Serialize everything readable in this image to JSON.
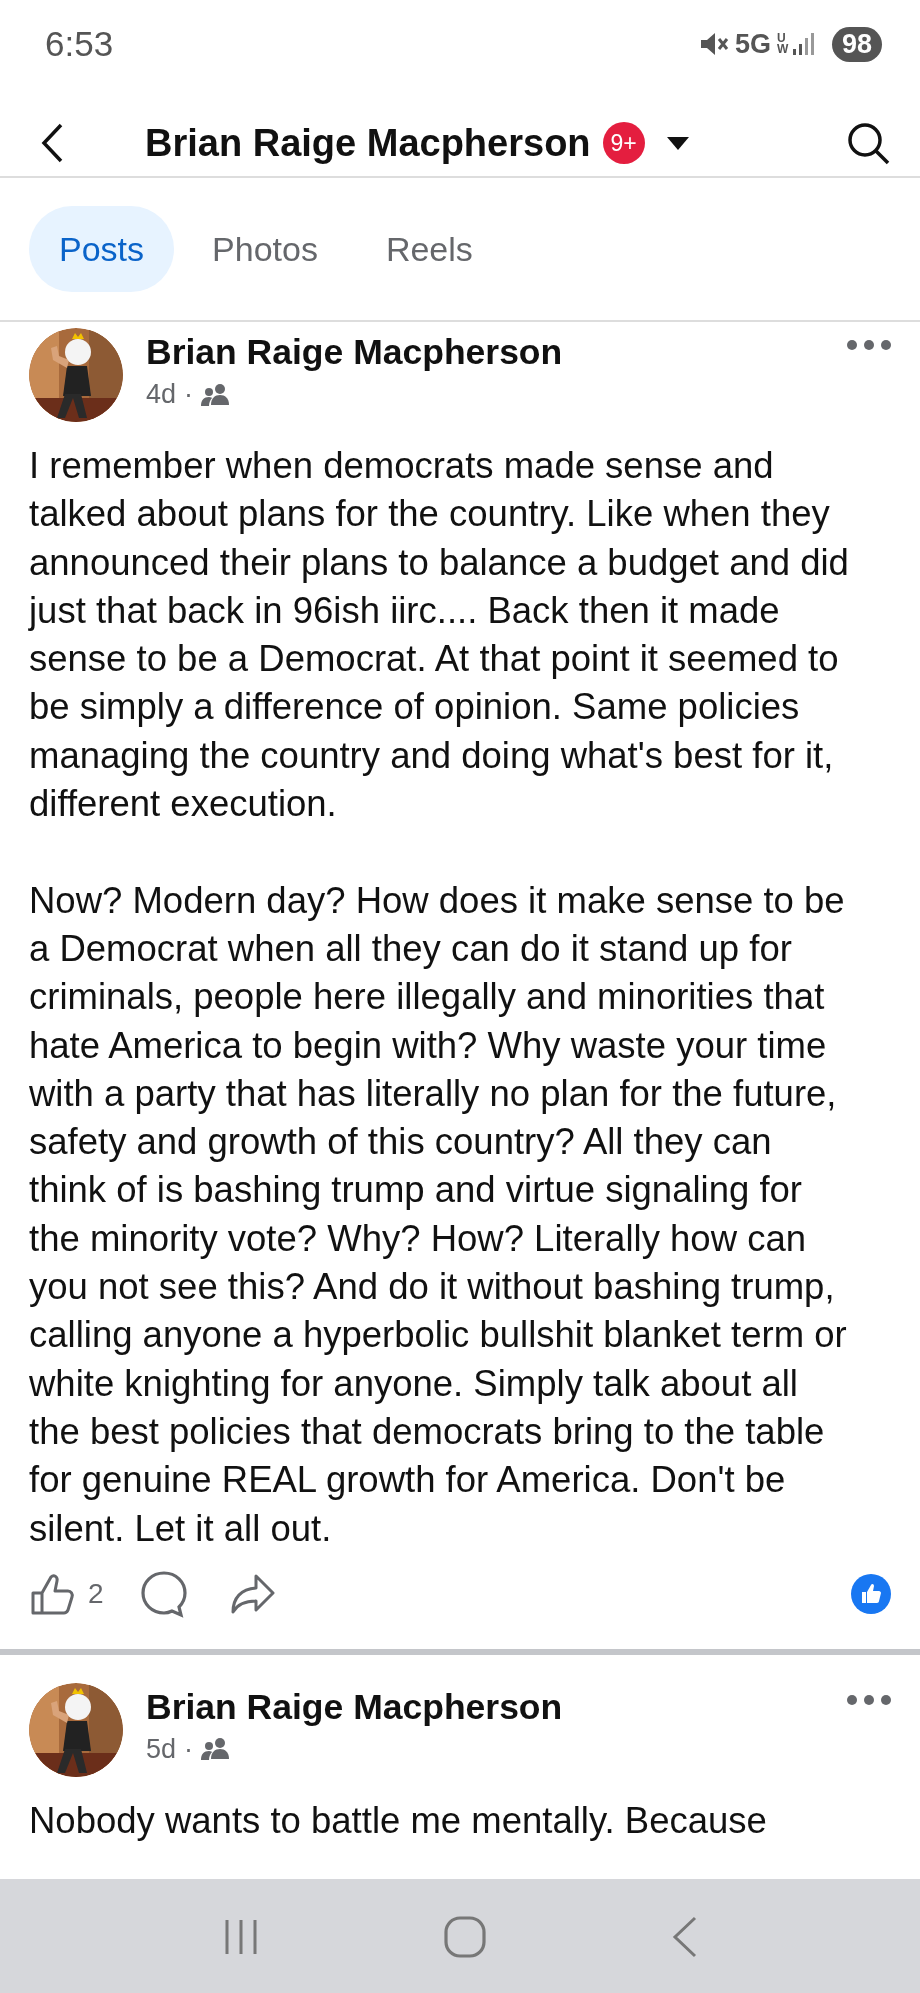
{
  "status_bar": {
    "time": "6:53",
    "network": "5G",
    "network_suffix": "UW",
    "battery": "98"
  },
  "header": {
    "title": "Brian Raige Macpherson",
    "badge": "9+"
  },
  "tabs": [
    {
      "label": "Posts",
      "selected": true
    },
    {
      "label": "Photos",
      "selected": false
    },
    {
      "label": "Reels",
      "selected": false
    }
  ],
  "posts": [
    {
      "author": "Brian Raige Macpherson",
      "age": "4d",
      "separator": "·",
      "paragraphs": [
        "I remember when democrats made sense and\ntalked about plans for the country. Like when they\nannounced their plans to balance a budget and did\njust that back in 96ish iirc.... Back then it made\nsense to be a Democrat. At that point it seemed to\nbe simply a difference of opinion. Same policies\nmanaging the country and doing what's best for it,\ndifferent execution.",
        "Now? Modern day? How does it make sense to be\na Democrat when all they can do it stand up for\ncriminals, people here illegally and minorities that\nhate America to begin with? Why waste your time\nwith a party that has literally no plan for the future,\nsafety and growth of this country? All they can\nthink of is bashing trump and virtue signaling for\nthe minority vote? Why? How? Literally how can\nyou not see this? And do it without bashing trump,\ncalling anyone a hyperbolic bullshit blanket term or\nwhite knighting for anyone. Simply talk about all\nthe best policies that democrats bring to the table\nfor genuine REAL growth for America. Don't be\nsilent. Let it all out."
      ],
      "likes": "2"
    },
    {
      "author": "Brian Raige Macpherson",
      "age": "5d",
      "separator": "·",
      "paragraphs": [
        "Nobody wants to battle me mentally. Because"
      ]
    }
  ]
}
